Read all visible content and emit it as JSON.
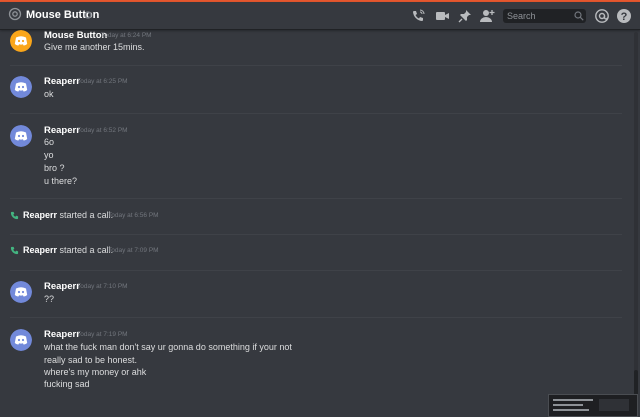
{
  "header": {
    "channel_name": "Mouse Button",
    "search_placeholder": "Search"
  },
  "colors": {
    "background": "#36393f",
    "accent_orange": "#faa61a",
    "blurple": "#7289da",
    "call_green": "#43b581"
  },
  "messages": [
    {
      "author": "Mouse Button",
      "timestamp": "Today at 6:24 PM",
      "avatar_color": "#faa61a",
      "lines": [
        "Give me another 15mins."
      ]
    },
    {
      "author": "Reaperr",
      "timestamp": "Today at 6:25 PM",
      "avatar_color": "#7289da",
      "lines": [
        "ok"
      ]
    },
    {
      "author": "Reaperr",
      "timestamp": "Today at 6:52 PM",
      "avatar_color": "#7289da",
      "lines": [
        "6o",
        "yo",
        "bro ?",
        "u there?"
      ]
    },
    {
      "system": true,
      "actor": "Reaperr",
      "text": "started a call.",
      "timestamp": "Today at 6:56 PM"
    },
    {
      "system": true,
      "actor": "Reaperr",
      "text": "started a call.",
      "timestamp": "Today at 7:09 PM"
    },
    {
      "author": "Reaperr",
      "timestamp": "Today at 7:10 PM",
      "avatar_color": "#7289da",
      "lines": [
        "??"
      ]
    },
    {
      "author": "Reaperr",
      "timestamp": "Today at 7:19 PM",
      "avatar_color": "#7289da",
      "lines": [
        "what the fuck man don't say ur gonna do something if your not",
        "really sad to be honest.",
        "where's my money or ahk",
        "fucking sad"
      ]
    }
  ]
}
